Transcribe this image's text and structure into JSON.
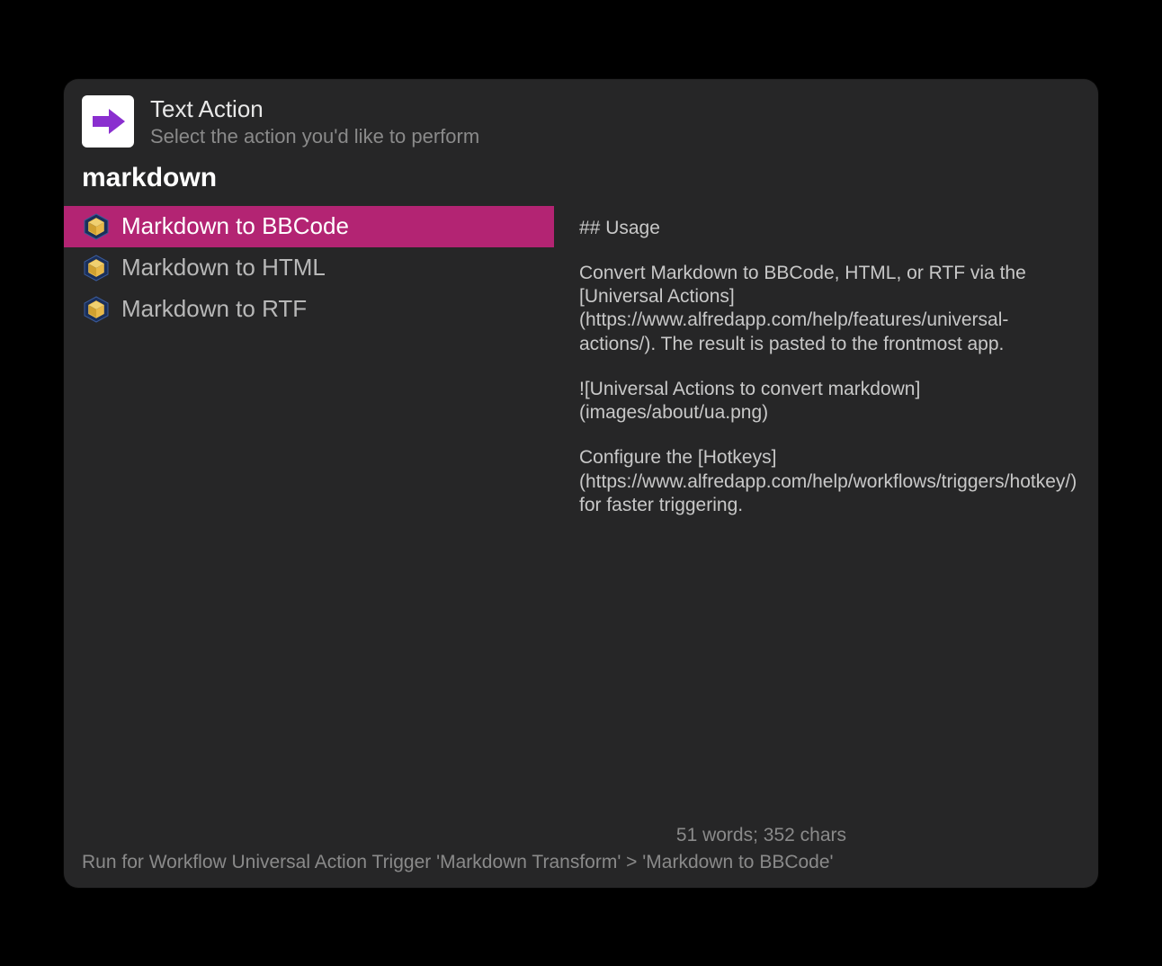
{
  "header": {
    "title": "Text Action",
    "subtitle": "Select the action you'd like to perform"
  },
  "query": "markdown",
  "list": {
    "items": [
      {
        "label": "Markdown to BBCode",
        "selected": true
      },
      {
        "label": "Markdown to HTML",
        "selected": false
      },
      {
        "label": "Markdown to RTF",
        "selected": false
      }
    ]
  },
  "preview": {
    "paragraphs": [
      "## Usage",
      "Convert Markdown to BBCode, HTML, or RTF via the [Universal Actions](https://www.alfredapp.com/help/features/universal-actions/). The result is pasted to the frontmost app.",
      "![Universal Actions to convert markdown](images/about/ua.png)",
      "Configure the [Hotkeys](https://www.alfredapp.com/help/workflows/triggers/hotkey/) for faster triggering."
    ]
  },
  "footer": {
    "stats": "51 words; 352 chars",
    "path": "Run for Workflow Universal Action Trigger 'Markdown Transform' > 'Markdown to BBCode'"
  }
}
